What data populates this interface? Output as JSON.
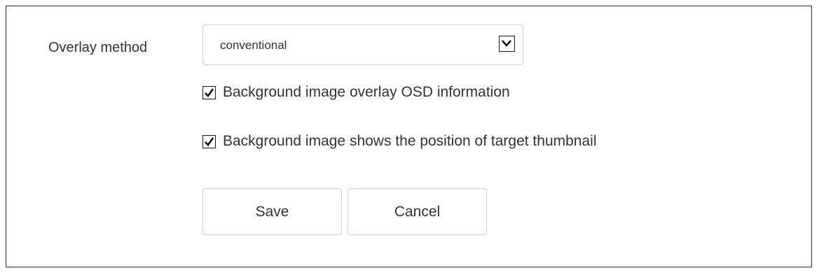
{
  "form": {
    "overlay_method_label": "Overlay method",
    "overlay_method_value": "conventional",
    "checkboxes": [
      {
        "label": "Background image overlay OSD information",
        "checked": true
      },
      {
        "label": "Background image shows the position of target thumbnail",
        "checked": true
      }
    ],
    "save_label": "Save",
    "cancel_label": "Cancel"
  },
  "icons": {
    "dropdown": "chevron-down-icon",
    "checkmark": "checkmark-icon"
  },
  "colors": {
    "text": "#333333",
    "border": "#cfcfcf",
    "frame": "#2b2b2b"
  }
}
